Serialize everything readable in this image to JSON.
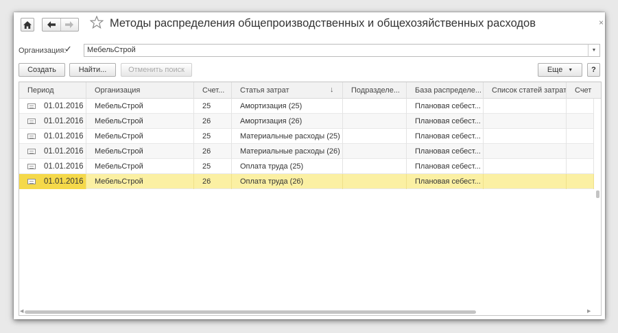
{
  "window": {
    "title": "Методы распределения общепроизводственных и общехозяйственных расходов",
    "close_glyph": "×"
  },
  "filter": {
    "label": "Организация:",
    "checked": true,
    "check_glyph": "✓",
    "value": "МебельСтрой"
  },
  "toolbar": {
    "create_label": "Создать",
    "find_label": "Найти...",
    "cancel_search_label": "Отменить поиск",
    "more_label": "Еще",
    "help_label": "?"
  },
  "table": {
    "columns": [
      "Период",
      "Организация",
      "Счет...",
      "Статья затрат",
      "Подразделе...",
      "База распределе...",
      "Список статей затрат",
      "Счет"
    ],
    "sort_glyph": "↓",
    "rows": [
      {
        "period": "01.01.2016",
        "org": "МебельСтрой",
        "account": "25",
        "item": "Амортизация (25)",
        "dept": "",
        "base": "Плановая себест...",
        "list": "",
        "acc2": ""
      },
      {
        "period": "01.01.2016",
        "org": "МебельСтрой",
        "account": "26",
        "item": "Амортизация (26)",
        "dept": "",
        "base": "Плановая себест...",
        "list": "",
        "acc2": ""
      },
      {
        "period": "01.01.2016",
        "org": "МебельСтрой",
        "account": "25",
        "item": "Материальные расходы (25)",
        "dept": "",
        "base": "Плановая себест...",
        "list": "",
        "acc2": ""
      },
      {
        "period": "01.01.2016",
        "org": "МебельСтрой",
        "account": "26",
        "item": "Материальные расходы (26)",
        "dept": "",
        "base": "Плановая себест...",
        "list": "",
        "acc2": ""
      },
      {
        "period": "01.01.2016",
        "org": "МебельСтрой",
        "account": "25",
        "item": "Оплата труда (25)",
        "dept": "",
        "base": "Плановая себест...",
        "list": "",
        "acc2": ""
      },
      {
        "period": "01.01.2016",
        "org": "МебельСтрой",
        "account": "26",
        "item": "Оплата труда (26)",
        "dept": "",
        "base": "Плановая себест...",
        "list": "",
        "acc2": ""
      }
    ],
    "selected_row": 5
  },
  "icons": {
    "home": "home-icon",
    "back": "arrow-left-icon",
    "forward": "arrow-right-icon",
    "favorite": "star-icon",
    "record": "record-icon"
  }
}
